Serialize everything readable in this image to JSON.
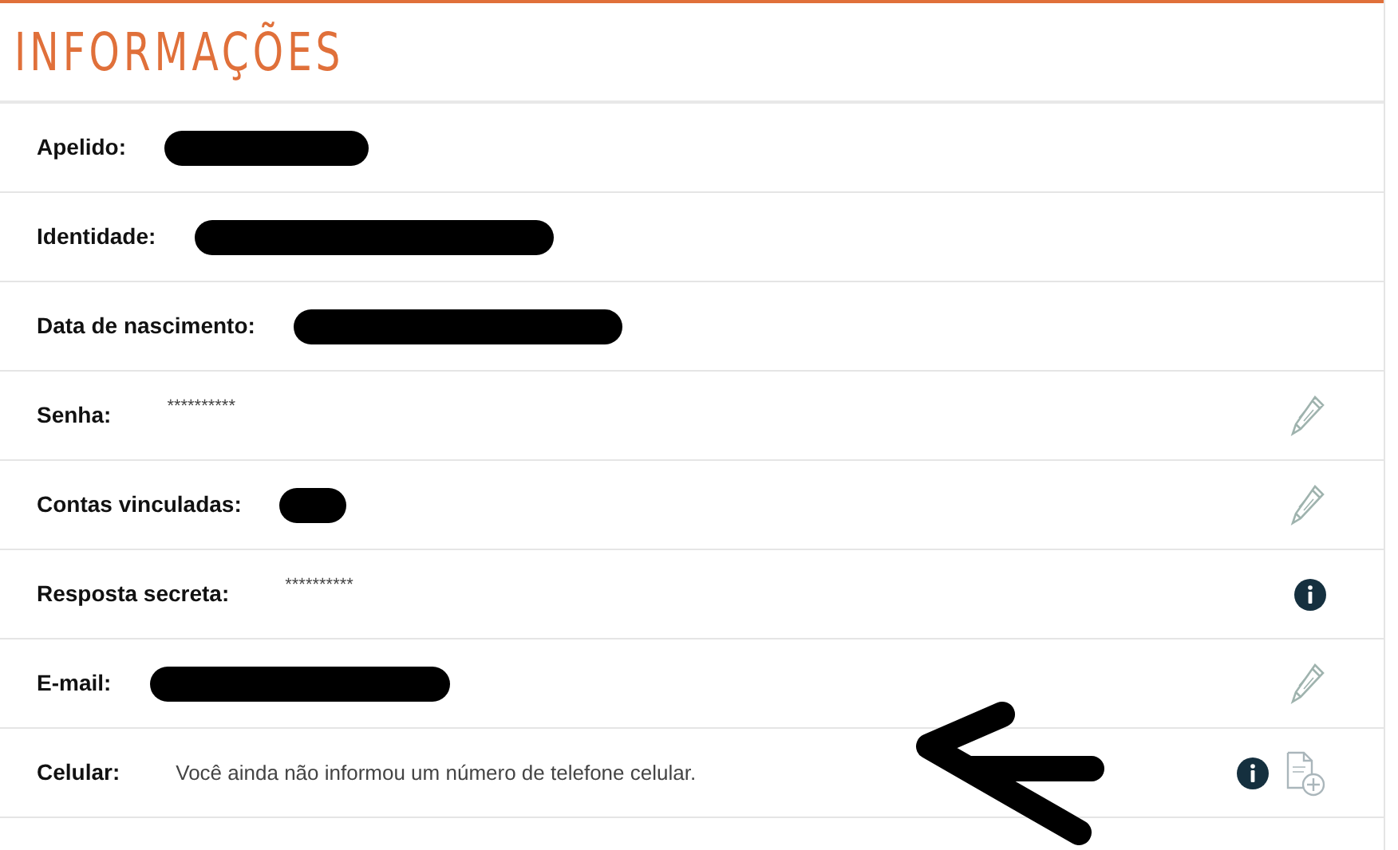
{
  "title": "INFORMAÇÕES",
  "rows": [
    {
      "label": "Apelido:",
      "value": {
        "kind": "redacted"
      },
      "actions": []
    },
    {
      "label": "Identidade:",
      "value": {
        "kind": "redacted"
      },
      "actions": []
    },
    {
      "label": "Data de nascimento:",
      "value": {
        "kind": "redacted"
      },
      "actions": []
    },
    {
      "label": "Senha:",
      "value": {
        "kind": "text",
        "text": "**********"
      },
      "actions": [
        {
          "kind": "edit"
        }
      ]
    },
    {
      "label": "Contas vinculadas:",
      "value": {
        "kind": "redacted"
      },
      "actions": [
        {
          "kind": "edit"
        }
      ]
    },
    {
      "label": "Resposta secreta:",
      "value": {
        "kind": "text",
        "text": "**********"
      },
      "actions": [
        {
          "kind": "info"
        }
      ]
    },
    {
      "label": "E-mail:",
      "value": {
        "kind": "redacted"
      },
      "actions": [
        {
          "kind": "edit"
        }
      ]
    },
    {
      "label": "Celular:",
      "value": {
        "kind": "text",
        "text": "Você ainda não informou um número de telefone celular."
      },
      "actions": [
        {
          "kind": "info"
        },
        {
          "kind": "add-document"
        }
      ]
    }
  ]
}
